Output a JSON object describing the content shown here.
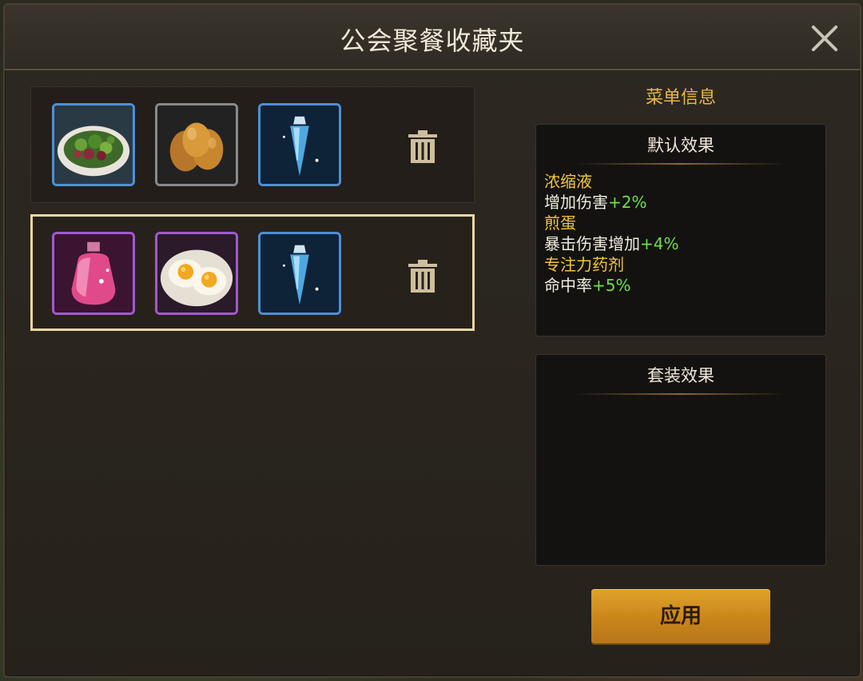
{
  "window": {
    "title": "公会聚餐收藏夹"
  },
  "menus": [
    {
      "selected": false,
      "items": [
        {
          "icon": "salad-icon",
          "rarity": "blue"
        },
        {
          "icon": "eggs-icon",
          "rarity": "gray"
        },
        {
          "icon": "concentrate-vial-icon",
          "rarity": "blue"
        }
      ]
    },
    {
      "selected": true,
      "items": [
        {
          "icon": "potion-bottle-icon",
          "rarity": "purple"
        },
        {
          "icon": "fried-egg-icon",
          "rarity": "purple"
        },
        {
          "icon": "concentrate-vial-icon",
          "rarity": "blue"
        }
      ]
    }
  ],
  "info": {
    "title": "菜单信息",
    "default": {
      "title": "默认效果",
      "effects": [
        {
          "name": "浓缩液",
          "desc": "增加伤害",
          "value": "+2%"
        },
        {
          "name": "煎蛋",
          "desc": "暴击伤害增加",
          "value": "+4%"
        },
        {
          "name": "专注力药剂",
          "desc": "命中率",
          "value": "+5%"
        }
      ]
    },
    "set": {
      "title": "套装效果"
    }
  },
  "apply_label": "应用",
  "colors": {
    "accent": "#e8b848",
    "positive": "#6ee04a",
    "name": "#f2c63a",
    "button": "#d4931f"
  }
}
